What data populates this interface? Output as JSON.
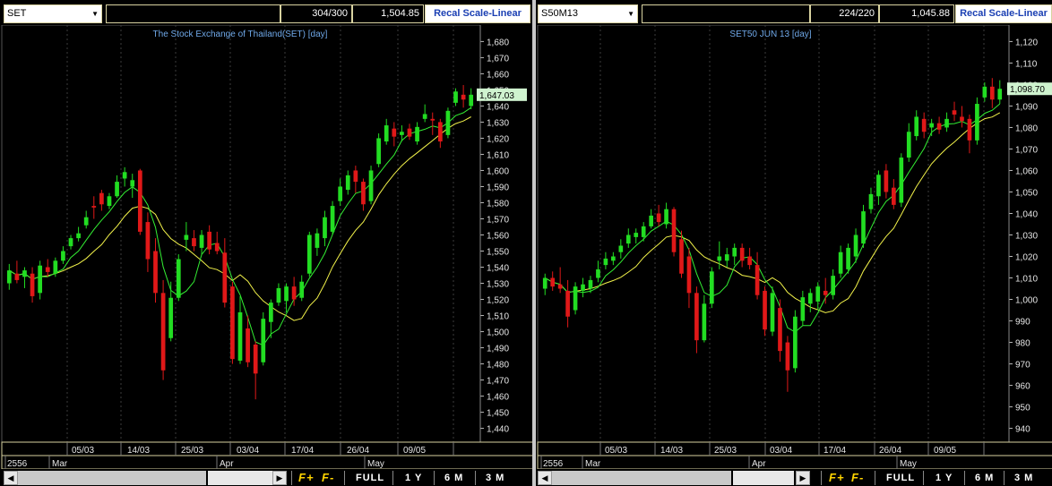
{
  "panels": [
    {
      "symbol": "SET",
      "count": "304/300",
      "last_value": "1,504.85",
      "scale_button": "Recal Scale-Linear",
      "title": "The Stock Exchange of Thailand(SET) [day]",
      "price_tag": "1,647.03",
      "year_label": "2556",
      "date_ticks": [
        "05/03",
        "14/03",
        "25/03",
        "03/04",
        "17/04",
        "26/04",
        "09/05"
      ],
      "month_labels": [
        "Mar",
        "Apr",
        "May"
      ],
      "controls": {
        "f_plus": "F+",
        "f_minus": "F-",
        "full": "FULL",
        "y1": "1 Y",
        "m6": "6 M",
        "m3": "3 M"
      }
    },
    {
      "symbol": "S50M13",
      "count": "224/220",
      "last_value": "1,045.88",
      "scale_button": "Recal Scale-Linear",
      "title": "SET50 JUN 13   [day]",
      "price_tag": "1,098.70",
      "year_label": "2556",
      "date_ticks": [
        "05/03",
        "14/03",
        "25/03",
        "03/04",
        "17/04",
        "26/04",
        "09/05"
      ],
      "month_labels": [
        "Mar",
        "Apr",
        "May"
      ],
      "controls": {
        "f_plus": "F+",
        "f_minus": "F-",
        "full": "FULL",
        "y1": "1 Y",
        "m6": "6 M",
        "m3": "3 M"
      }
    }
  ],
  "chart_data": [
    {
      "type": "candlestick",
      "title": "The Stock Exchange of Thailand(SET) [day]",
      "ylim": [
        1432,
        1688
      ],
      "yticks": [
        1440,
        1450,
        1460,
        1470,
        1480,
        1490,
        1500,
        1510,
        1520,
        1530,
        1540,
        1550,
        1560,
        1570,
        1580,
        1590,
        1600,
        1610,
        1620,
        1630,
        1640,
        1650,
        1660,
        1670,
        1680
      ],
      "ytick_labels": [
        "1,440",
        "1,450",
        "1,460",
        "1,470",
        "1,480",
        "1,490",
        "1,500",
        "1,510",
        "1,520",
        "1,530",
        "1,540",
        "1,550",
        "1,560",
        "1,570",
        "1,580",
        "1,590",
        "1,600",
        "1,610",
        "1,620",
        "1,630",
        "1,640",
        "1,650",
        "1,660",
        "1,670",
        "1,680"
      ],
      "candles": [
        {
          "o": 1530,
          "h": 1542,
          "l": 1526,
          "c": 1538
        },
        {
          "o": 1536,
          "h": 1544,
          "l": 1530,
          "c": 1532
        },
        {
          "o": 1534,
          "h": 1540,
          "l": 1527,
          "c": 1538
        },
        {
          "o": 1536,
          "h": 1540,
          "l": 1518,
          "c": 1522
        },
        {
          "o": 1524,
          "h": 1544,
          "l": 1520,
          "c": 1541
        },
        {
          "o": 1540,
          "h": 1545,
          "l": 1534,
          "c": 1537
        },
        {
          "o": 1536,
          "h": 1546,
          "l": 1534,
          "c": 1544
        },
        {
          "o": 1544,
          "h": 1553,
          "l": 1542,
          "c": 1550
        },
        {
          "o": 1553,
          "h": 1560,
          "l": 1551,
          "c": 1558
        },
        {
          "o": 1558,
          "h": 1565,
          "l": 1556,
          "c": 1561
        },
        {
          "o": 1566,
          "h": 1575,
          "l": 1564,
          "c": 1571
        },
        {
          "o": 1578,
          "h": 1584,
          "l": 1570,
          "c": 1577
        },
        {
          "o": 1586,
          "h": 1588,
          "l": 1575,
          "c": 1579
        },
        {
          "o": 1578,
          "h": 1586,
          "l": 1576,
          "c": 1584
        },
        {
          "o": 1584,
          "h": 1597,
          "l": 1583,
          "c": 1593
        },
        {
          "o": 1595,
          "h": 1602,
          "l": 1590,
          "c": 1599
        },
        {
          "o": 1590,
          "h": 1598,
          "l": 1583,
          "c": 1594
        },
        {
          "o": 1600,
          "h": 1601,
          "l": 1560,
          "c": 1562
        },
        {
          "o": 1568,
          "h": 1574,
          "l": 1537,
          "c": 1545
        },
        {
          "o": 1550,
          "h": 1558,
          "l": 1518,
          "c": 1524
        },
        {
          "o": 1524,
          "h": 1532,
          "l": 1470,
          "c": 1476
        },
        {
          "o": 1496,
          "h": 1531,
          "l": 1494,
          "c": 1521
        },
        {
          "o": 1521,
          "h": 1548,
          "l": 1519,
          "c": 1545
        },
        {
          "o": 1557,
          "h": 1568,
          "l": 1550,
          "c": 1560
        },
        {
          "o": 1558,
          "h": 1563,
          "l": 1550,
          "c": 1553
        },
        {
          "o": 1552,
          "h": 1563,
          "l": 1548,
          "c": 1560
        },
        {
          "o": 1562,
          "h": 1566,
          "l": 1548,
          "c": 1551
        },
        {
          "o": 1555,
          "h": 1562,
          "l": 1548,
          "c": 1550
        },
        {
          "o": 1549,
          "h": 1558,
          "l": 1515,
          "c": 1518
        },
        {
          "o": 1528,
          "h": 1531,
          "l": 1480,
          "c": 1483
        },
        {
          "o": 1482,
          "h": 1522,
          "l": 1480,
          "c": 1512
        },
        {
          "o": 1502,
          "h": 1510,
          "l": 1478,
          "c": 1481
        },
        {
          "o": 1492,
          "h": 1494,
          "l": 1458,
          "c": 1474
        },
        {
          "o": 1481,
          "h": 1512,
          "l": 1479,
          "c": 1508
        },
        {
          "o": 1506,
          "h": 1520,
          "l": 1496,
          "c": 1518
        },
        {
          "o": 1518,
          "h": 1530,
          "l": 1516,
          "c": 1527
        },
        {
          "o": 1519,
          "h": 1530,
          "l": 1512,
          "c": 1528
        },
        {
          "o": 1528,
          "h": 1534,
          "l": 1516,
          "c": 1520
        },
        {
          "o": 1521,
          "h": 1535,
          "l": 1519,
          "c": 1531
        },
        {
          "o": 1536,
          "h": 1562,
          "l": 1534,
          "c": 1560
        },
        {
          "o": 1552,
          "h": 1564,
          "l": 1547,
          "c": 1561
        },
        {
          "o": 1558,
          "h": 1575,
          "l": 1553,
          "c": 1571
        },
        {
          "o": 1562,
          "h": 1581,
          "l": 1560,
          "c": 1578
        },
        {
          "o": 1581,
          "h": 1595,
          "l": 1578,
          "c": 1590
        },
        {
          "o": 1588,
          "h": 1600,
          "l": 1585,
          "c": 1597
        },
        {
          "o": 1600,
          "h": 1603,
          "l": 1586,
          "c": 1593
        },
        {
          "o": 1593,
          "h": 1595,
          "l": 1575,
          "c": 1579
        },
        {
          "o": 1581,
          "h": 1603,
          "l": 1579,
          "c": 1600
        },
        {
          "o": 1604,
          "h": 1623,
          "l": 1602,
          "c": 1620
        },
        {
          "o": 1618,
          "h": 1632,
          "l": 1616,
          "c": 1628
        },
        {
          "o": 1626,
          "h": 1630,
          "l": 1615,
          "c": 1621
        },
        {
          "o": 1622,
          "h": 1628,
          "l": 1618,
          "c": 1624
        },
        {
          "o": 1626,
          "h": 1629,
          "l": 1619,
          "c": 1621
        },
        {
          "o": 1618,
          "h": 1630,
          "l": 1616,
          "c": 1627
        },
        {
          "o": 1632,
          "h": 1641,
          "l": 1630,
          "c": 1635
        },
        {
          "o": 1632,
          "h": 1636,
          "l": 1622,
          "c": 1631
        },
        {
          "o": 1630,
          "h": 1632,
          "l": 1614,
          "c": 1618
        },
        {
          "o": 1622,
          "h": 1639,
          "l": 1620,
          "c": 1637
        },
        {
          "o": 1642,
          "h": 1651,
          "l": 1640,
          "c": 1649
        },
        {
          "o": 1647,
          "h": 1653,
          "l": 1639,
          "c": 1644
        },
        {
          "o": 1640,
          "h": 1651,
          "l": 1638,
          "c": 1647
        }
      ]
    },
    {
      "type": "candlestick",
      "title": "SET50 JUN 13   [day]",
      "ylim": [
        934,
        1126
      ],
      "yticks": [
        940,
        950,
        960,
        970,
        980,
        990,
        1000,
        1010,
        1020,
        1030,
        1040,
        1050,
        1060,
        1070,
        1080,
        1090,
        1100,
        1110,
        1120
      ],
      "ytick_labels": [
        "940",
        "950",
        "960",
        "970",
        "980",
        "990",
        "1,000",
        "1,010",
        "1,020",
        "1,030",
        "1,040",
        "1,050",
        "1,060",
        "1,070",
        "1,080",
        "1,090",
        "1,100",
        "1,110",
        "1,120"
      ],
      "candles": [
        {
          "o": 1005,
          "h": 1012,
          "l": 1002,
          "c": 1010
        },
        {
          "o": 1010,
          "h": 1013,
          "l": 1004,
          "c": 1006
        },
        {
          "o": 1007,
          "h": 1015,
          "l": 1003,
          "c": 1005
        },
        {
          "o": 1004,
          "h": 1009,
          "l": 987,
          "c": 992
        },
        {
          "o": 995,
          "h": 1008,
          "l": 993,
          "c": 1006
        },
        {
          "o": 1004,
          "h": 1010,
          "l": 1001,
          "c": 1007
        },
        {
          "o": 1005,
          "h": 1011,
          "l": 1003,
          "c": 1009
        },
        {
          "o": 1010,
          "h": 1018,
          "l": 1008,
          "c": 1014
        },
        {
          "o": 1016,
          "h": 1022,
          "l": 1014,
          "c": 1019
        },
        {
          "o": 1018,
          "h": 1022,
          "l": 1016,
          "c": 1020
        },
        {
          "o": 1022,
          "h": 1028,
          "l": 1019,
          "c": 1025
        },
        {
          "o": 1026,
          "h": 1033,
          "l": 1024,
          "c": 1030
        },
        {
          "o": 1029,
          "h": 1033,
          "l": 1026,
          "c": 1031
        },
        {
          "o": 1029,
          "h": 1036,
          "l": 1027,
          "c": 1034
        },
        {
          "o": 1034,
          "h": 1042,
          "l": 1033,
          "c": 1039
        },
        {
          "o": 1040,
          "h": 1044,
          "l": 1034,
          "c": 1036
        },
        {
          "o": 1035,
          "h": 1045,
          "l": 1033,
          "c": 1042
        },
        {
          "o": 1042,
          "h": 1043,
          "l": 1020,
          "c": 1022
        },
        {
          "o": 1028,
          "h": 1032,
          "l": 1010,
          "c": 1012
        },
        {
          "o": 1020,
          "h": 1024,
          "l": 996,
          "c": 1003
        },
        {
          "o": 1003,
          "h": 1006,
          "l": 975,
          "c": 981
        },
        {
          "o": 981,
          "h": 1002,
          "l": 980,
          "c": 998
        },
        {
          "o": 998,
          "h": 1015,
          "l": 996,
          "c": 1013
        },
        {
          "o": 1018,
          "h": 1027,
          "l": 1014,
          "c": 1020
        },
        {
          "o": 1018,
          "h": 1024,
          "l": 1015,
          "c": 1021
        },
        {
          "o": 1020,
          "h": 1026,
          "l": 1016,
          "c": 1024
        },
        {
          "o": 1024,
          "h": 1026,
          "l": 1015,
          "c": 1018
        },
        {
          "o": 1020,
          "h": 1024,
          "l": 1014,
          "c": 1016
        },
        {
          "o": 1016,
          "h": 1022,
          "l": 1000,
          "c": 1002
        },
        {
          "o": 1004,
          "h": 1006,
          "l": 983,
          "c": 986
        },
        {
          "o": 985,
          "h": 1006,
          "l": 983,
          "c": 1003
        },
        {
          "o": 996,
          "h": 1000,
          "l": 971,
          "c": 976
        },
        {
          "o": 980,
          "h": 983,
          "l": 957,
          "c": 967
        },
        {
          "o": 968,
          "h": 995,
          "l": 966,
          "c": 992
        },
        {
          "o": 990,
          "h": 1004,
          "l": 988,
          "c": 1001
        },
        {
          "o": 998,
          "h": 1005,
          "l": 994,
          "c": 1003
        },
        {
          "o": 999,
          "h": 1008,
          "l": 995,
          "c": 1006
        },
        {
          "o": 1004,
          "h": 1010,
          "l": 998,
          "c": 1002
        },
        {
          "o": 1002,
          "h": 1014,
          "l": 1000,
          "c": 1011
        },
        {
          "o": 1012,
          "h": 1025,
          "l": 1010,
          "c": 1022
        },
        {
          "o": 1014,
          "h": 1026,
          "l": 1012,
          "c": 1024
        },
        {
          "o": 1020,
          "h": 1033,
          "l": 1017,
          "c": 1030
        },
        {
          "o": 1026,
          "h": 1044,
          "l": 1024,
          "c": 1041
        },
        {
          "o": 1042,
          "h": 1052,
          "l": 1040,
          "c": 1049
        },
        {
          "o": 1048,
          "h": 1060,
          "l": 1044,
          "c": 1058
        },
        {
          "o": 1060,
          "h": 1063,
          "l": 1047,
          "c": 1050
        },
        {
          "o": 1052,
          "h": 1056,
          "l": 1042,
          "c": 1044
        },
        {
          "o": 1045,
          "h": 1068,
          "l": 1043,
          "c": 1066
        },
        {
          "o": 1066,
          "h": 1082,
          "l": 1064,
          "c": 1078
        },
        {
          "o": 1076,
          "h": 1088,
          "l": 1074,
          "c": 1085
        },
        {
          "o": 1084,
          "h": 1087,
          "l": 1075,
          "c": 1078
        },
        {
          "o": 1080,
          "h": 1084,
          "l": 1076,
          "c": 1082
        },
        {
          "o": 1082,
          "h": 1085,
          "l": 1077,
          "c": 1079
        },
        {
          "o": 1080,
          "h": 1087,
          "l": 1078,
          "c": 1084
        },
        {
          "o": 1088,
          "h": 1092,
          "l": 1083,
          "c": 1086
        },
        {
          "o": 1085,
          "h": 1090,
          "l": 1080,
          "c": 1083
        },
        {
          "o": 1084,
          "h": 1086,
          "l": 1068,
          "c": 1074
        },
        {
          "o": 1074,
          "h": 1094,
          "l": 1072,
          "c": 1091
        },
        {
          "o": 1094,
          "h": 1101,
          "l": 1092,
          "c": 1099
        },
        {
          "o": 1099,
          "h": 1103,
          "l": 1089,
          "c": 1093
        },
        {
          "o": 1093,
          "h": 1102,
          "l": 1091,
          "c": 1098
        }
      ]
    }
  ],
  "colors": {
    "up": "#22dd22",
    "down": "#e01818",
    "ma_fast": "#33ee33",
    "ma_slow": "#f2f24a",
    "grid": "#3c3c3c",
    "title": "#6fa8e8",
    "price_tag_bg": "#cff3cf"
  }
}
